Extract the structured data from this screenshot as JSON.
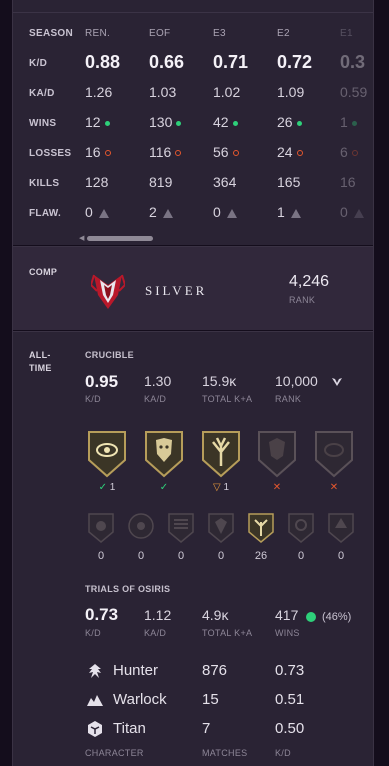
{
  "season": {
    "heading": "SEASON",
    "columns": [
      "REN.",
      "EOF",
      "E3",
      "E2",
      "E1"
    ],
    "rows": {
      "kd": {
        "label": "K/D",
        "values": [
          "0.88",
          "0.66",
          "0.71",
          "0.72",
          "0.3"
        ]
      },
      "kad": {
        "label": "KA/D",
        "values": [
          "1.26",
          "1.03",
          "1.02",
          "1.09",
          "0.59"
        ]
      },
      "wins": {
        "label": "WINS",
        "values": [
          "12",
          "130",
          "42",
          "26",
          "1"
        ]
      },
      "losses": {
        "label": "LOSSES",
        "values": [
          "16",
          "116",
          "56",
          "24",
          "6"
        ]
      },
      "kills": {
        "label": "KILLS",
        "values": [
          "128",
          "819",
          "364",
          "165",
          "16"
        ]
      },
      "flaw": {
        "label": "FLAW.",
        "values": [
          "0",
          "2",
          "0",
          "1",
          "0"
        ]
      }
    }
  },
  "comp": {
    "label": "COMP",
    "rank_name": "SILVER",
    "points": "4,246",
    "points_label": "RANK"
  },
  "alltime": {
    "label_line1": "ALL-",
    "label_line2": "TIME",
    "crucible": {
      "heading": "CRUCIBLE",
      "kd": "0.95",
      "kd_label": "K/D",
      "kad": "1.30",
      "kad_label": "KA/D",
      "total": "15.9ĸ",
      "total_label": "TOTAL K+A",
      "rank": "10,000",
      "rank_label": "RANK"
    },
    "emblems": [
      {
        "name": "emblem-eye",
        "mark": "✓",
        "count": "1",
        "state": "check"
      },
      {
        "name": "emblem-face",
        "mark": "✓",
        "count": "",
        "state": "check"
      },
      {
        "name": "emblem-tree",
        "mark": "▽",
        "count": "1",
        "state": "shield"
      },
      {
        "name": "emblem-dark-1",
        "mark": "✕",
        "count": "",
        "state": "cross"
      },
      {
        "name": "emblem-dark-2",
        "mark": "✕",
        "count": "",
        "state": "cross"
      }
    ],
    "small_emblems": [
      "0",
      "0",
      "0",
      "0",
      "26",
      "0",
      "0"
    ],
    "trials": {
      "heading": "TRIALS OF OSIRIS",
      "kd": "0.73",
      "kd_label": "K/D",
      "kad": "1.12",
      "kad_label": "KA/D",
      "total": "4.9ĸ",
      "total_label": "TOTAL K+A",
      "wins": "417",
      "wins_label": "WINS",
      "win_pct": "(46%)"
    },
    "classes": [
      {
        "name": "Hunter",
        "matches": "876",
        "kd": "0.73"
      },
      {
        "name": "Warlock",
        "matches": "15",
        "kd": "0.51"
      },
      {
        "name": "Titan",
        "matches": "7",
        "kd": "0.50"
      }
    ],
    "class_headers": {
      "character": "CHARACTER",
      "matches": "MATCHES",
      "kd": "K/D"
    }
  },
  "colors": {
    "accent_green": "#2ed07a",
    "loss_orange": "#e4572e",
    "panel": "#2a2334",
    "background": "#140d1c"
  }
}
